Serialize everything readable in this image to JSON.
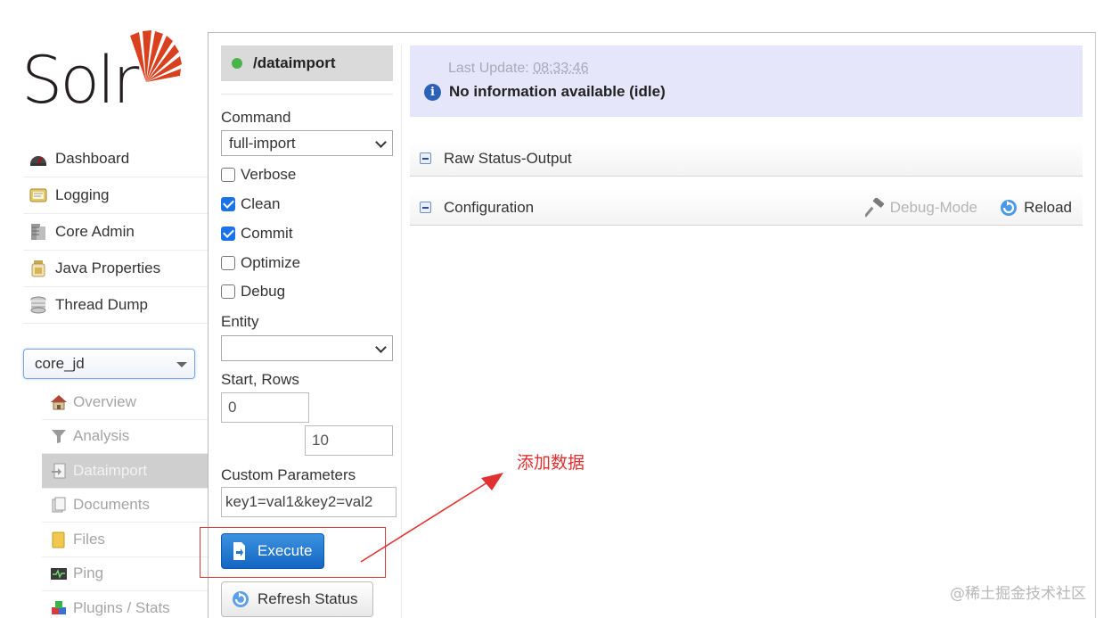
{
  "logo": {
    "text": "Solr",
    "accent_color": "#d9411e"
  },
  "nav": {
    "items": [
      {
        "label": "Dashboard",
        "icon": "dashboard-icon"
      },
      {
        "label": "Logging",
        "icon": "logging-icon"
      },
      {
        "label": "Core Admin",
        "icon": "core-admin-icon"
      },
      {
        "label": "Java Properties",
        "icon": "java-properties-icon"
      },
      {
        "label": "Thread Dump",
        "icon": "thread-dump-icon"
      }
    ]
  },
  "core_selector": {
    "value": "core_jd"
  },
  "core_nav": {
    "items": [
      {
        "label": "Overview",
        "icon": "home-icon"
      },
      {
        "label": "Analysis",
        "icon": "funnel-icon"
      },
      {
        "label": "Dataimport",
        "icon": "import-icon",
        "active": true
      },
      {
        "label": "Documents",
        "icon": "documents-icon"
      },
      {
        "label": "Files",
        "icon": "folder-icon"
      },
      {
        "label": "Ping",
        "icon": "ping-icon"
      },
      {
        "label": "Plugins / Stats",
        "icon": "plugins-icon"
      }
    ]
  },
  "dataimport": {
    "handler": "/dataimport",
    "command_label": "Command",
    "command_value": "full-import",
    "checkboxes": [
      {
        "label": "Verbose",
        "checked": false
      },
      {
        "label": "Clean",
        "checked": true
      },
      {
        "label": "Commit",
        "checked": true
      },
      {
        "label": "Optimize",
        "checked": false
      },
      {
        "label": "Debug",
        "checked": false
      }
    ],
    "entity_label": "Entity",
    "entity_value": "",
    "start_rows_label": "Start, Rows",
    "start_value": "0",
    "rows_value": "10",
    "custom_params_label": "Custom Parameters",
    "custom_params_value": "key1=val1&key2=val2",
    "execute_label": "Execute",
    "refresh_label": "Refresh Status"
  },
  "status": {
    "last_update_label": "Last Update:",
    "last_update_time": "08:33:46",
    "message": "No information available (idle)"
  },
  "sections": {
    "raw_status": "Raw Status-Output",
    "configuration": "Configuration",
    "debug_mode": "Debug-Mode",
    "reload": "Reload"
  },
  "annotation": {
    "text": "添加数据",
    "color": "#e03030"
  },
  "watermark": "@稀土掘金技术社区"
}
